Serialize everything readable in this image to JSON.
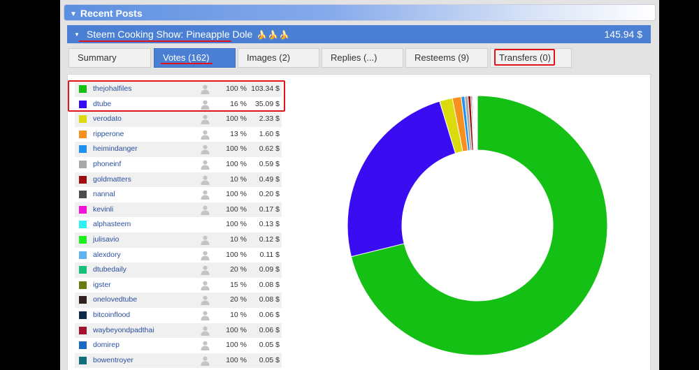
{
  "header": {
    "title": "Recent Posts"
  },
  "post": {
    "title": "Steem Cooking Show: Pineapple Dole",
    "bananas": "🍌🍌🍌",
    "amount": "145.94 $"
  },
  "tabs": [
    {
      "label": "Summary",
      "active": false
    },
    {
      "label": "Votes (162)",
      "active": true
    },
    {
      "label": "Images (2)",
      "active": false
    },
    {
      "label": "Replies (...)",
      "active": false
    },
    {
      "label": "Resteems (9)",
      "active": false
    },
    {
      "label": "Transfers (0)",
      "active": false
    }
  ],
  "voters": [
    {
      "name": "thejohalfiles",
      "percent": "100 %",
      "value": "103.34 $",
      "color": "#14c014"
    },
    {
      "name": "dtube",
      "percent": "16 %",
      "value": "35.09 $",
      "color": "#3a0cf2"
    },
    {
      "name": "verodato",
      "percent": "100 %",
      "value": "2.33 $",
      "color": "#dada0c"
    },
    {
      "name": "ripperone",
      "percent": "13 %",
      "value": "1.60 $",
      "color": "#f7901e"
    },
    {
      "name": "heimindanger",
      "percent": "100 %",
      "value": "0.62 $",
      "color": "#1e90ef"
    },
    {
      "name": "phoneinf",
      "percent": "100 %",
      "value": "0.59 $",
      "color": "#a8a8a8"
    },
    {
      "name": "goldmatters",
      "percent": "10 %",
      "value": "0.49 $",
      "color": "#9e0d0d"
    },
    {
      "name": "nannal",
      "percent": "100 %",
      "value": "0.20 $",
      "color": "#4d4d4d"
    },
    {
      "name": "kevinli",
      "percent": "100 %",
      "value": "0.17 $",
      "color": "#f012d9"
    },
    {
      "name": "alphasteem",
      "percent": "100 %",
      "value": "0.13 $",
      "color": "#2ef0f0"
    },
    {
      "name": "julisavio",
      "percent": "10 %",
      "value": "0.12 $",
      "color": "#1ef01e"
    },
    {
      "name": "alexdory",
      "percent": "100 %",
      "value": "0.11 $",
      "color": "#5fb4f0"
    },
    {
      "name": "dtubedaily",
      "percent": "20 %",
      "value": "0.09 $",
      "color": "#17c07a"
    },
    {
      "name": "igster",
      "percent": "15 %",
      "value": "0.08 $",
      "color": "#6b7a12"
    },
    {
      "name": "onelovedtube",
      "percent": "20 %",
      "value": "0.08 $",
      "color": "#33201e"
    },
    {
      "name": "bitcoinflood",
      "percent": "10 %",
      "value": "0.06 $",
      "color": "#0f2a4a"
    },
    {
      "name": "waybeyondpadthai",
      "percent": "100 %",
      "value": "0.06 $",
      "color": "#a0122e"
    },
    {
      "name": "domirep",
      "percent": "100 %",
      "value": "0.05 $",
      "color": "#1a6ac4"
    },
    {
      "name": "bowentroyer",
      "percent": "100 %",
      "value": "0.05 $",
      "color": "#136e7c"
    }
  ],
  "chart_data": {
    "type": "pie",
    "donut": true,
    "categories": [
      "thejohalfiles",
      "dtube",
      "verodato",
      "ripperone",
      "heimindanger",
      "phoneinf",
      "goldmatters",
      "nannal",
      "kevinli",
      "alphasteem",
      "julisavio",
      "alexdory",
      "dtubedaily",
      "igster",
      "onelovedtube",
      "bitcoinflood",
      "waybeyondpadthai",
      "domirep",
      "bowentroyer"
    ],
    "values": [
      103.34,
      35.09,
      2.33,
      1.6,
      0.62,
      0.59,
      0.49,
      0.2,
      0.17,
      0.13,
      0.12,
      0.11,
      0.09,
      0.08,
      0.08,
      0.06,
      0.06,
      0.05,
      0.05
    ],
    "total": 145.94,
    "colors": [
      "#14c014",
      "#3a0cf2",
      "#dada0c",
      "#f7901e",
      "#1e90ef",
      "#a8a8a8",
      "#9e0d0d",
      "#4d4d4d",
      "#f012d9",
      "#2ef0f0",
      "#1ef01e",
      "#5fb4f0",
      "#17c07a",
      "#6b7a12",
      "#33201e",
      "#0f2a4a",
      "#a0122e",
      "#1a6ac4",
      "#136e7c"
    ]
  }
}
